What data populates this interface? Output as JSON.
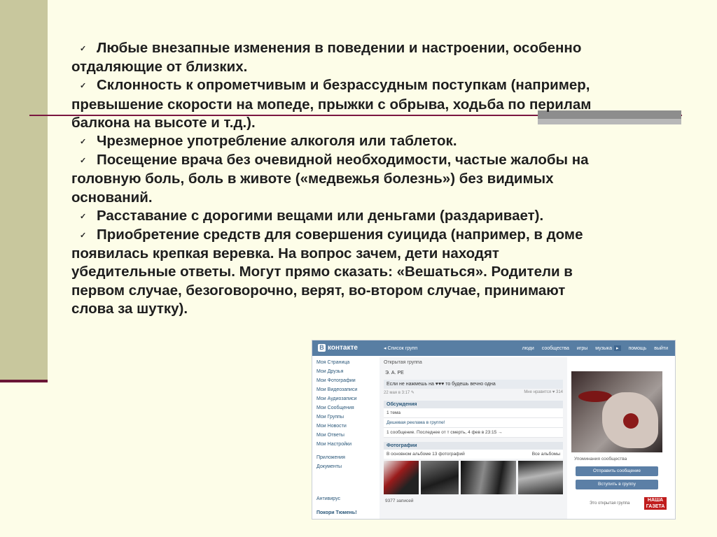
{
  "slide": {
    "paragraphs": [
      {
        "lines": [
          "Любые внезапные изменения в поведении и настроении, особенно",
          "отдаляющие от близких."
        ]
      },
      {
        "lines": [
          "Склонность к опрометчивым и безрассудным поступкам (например,",
          "превышение скорости на мопеде, прыжки с обрыва, ходьба по перилам",
          "балкона на высоте и т.д.)."
        ]
      },
      {
        "lines": [
          "Чрезмерное употребление алкоголя или таблеток."
        ]
      },
      {
        "lines": [
          "Посещение врача без очевидной необходимости, частые жалобы на",
          "головную боль, боль в животе («медвежья болезнь») без видимых",
          "оснований."
        ]
      },
      {
        "lines": [
          "Расставание с дорогими вещами или деньгами (раздаривает)."
        ]
      },
      {
        "lines": [
          "Приобретение средств для совершения суицида (например, в доме",
          "появилась крепкая веревка. На вопрос зачем, дети находят",
          "убедительные ответы. Могут прямо сказать: «Вешаться». Родители в",
          "первом случае, безоговорочно, верят, во-втором случае, принимают",
          "слова за шутку)."
        ]
      }
    ],
    "bullet_glyph": "✓"
  },
  "vk": {
    "logo": "контакте",
    "logo_letter": "В",
    "back_link": "◂  Список групп",
    "nav": [
      "люди",
      "сообщества",
      "игры",
      "музыка",
      "помощь",
      "выйти"
    ],
    "nav_arrow": "▸",
    "sidebar": [
      "Моя Страница",
      "Мои Друзья",
      "Мои Фотографии",
      "Мои Видеозаписи",
      "Мои Аудиозаписи",
      "Мои Сообщения",
      "Мои Группы",
      "Мои Новости",
      "Мои Ответы",
      "Мои Настройки"
    ],
    "sidebar2": [
      "Приложения",
      "Документы"
    ],
    "group_type": "Открытая группа",
    "group_name": "Э. А.  РЕ",
    "status": "Если не нажмешь на ♥♥♥ то будешь вечно одна",
    "status_meta_left": "22 мая в 3:17  ✎",
    "status_meta_right": "Мне нравится ♥ 314",
    "discussions_title": "Обсуждения",
    "discussions_count": "1 тема",
    "topic_title": "Дешевая реклама в группе!",
    "topic_meta": "1 сообщение. Последнее от т смерть, 4 фев в 23:15  →",
    "photos_title": "Фотографии",
    "photos_album": "В основном альбоме 13 фотографий",
    "photos_all": "Все альбомы",
    "posts": "9377 записей",
    "mentions": "Упоминания сообщества",
    "btn_message": "Отправить сообщение",
    "btn_join": "Вступить в группу",
    "open_group": "Это открытая группа",
    "nasha_line1": "НАША",
    "nasha_line2": "ГАЗЕТА",
    "ad1": "Антивирус",
    "ad2": "Покори Тюмень!"
  }
}
